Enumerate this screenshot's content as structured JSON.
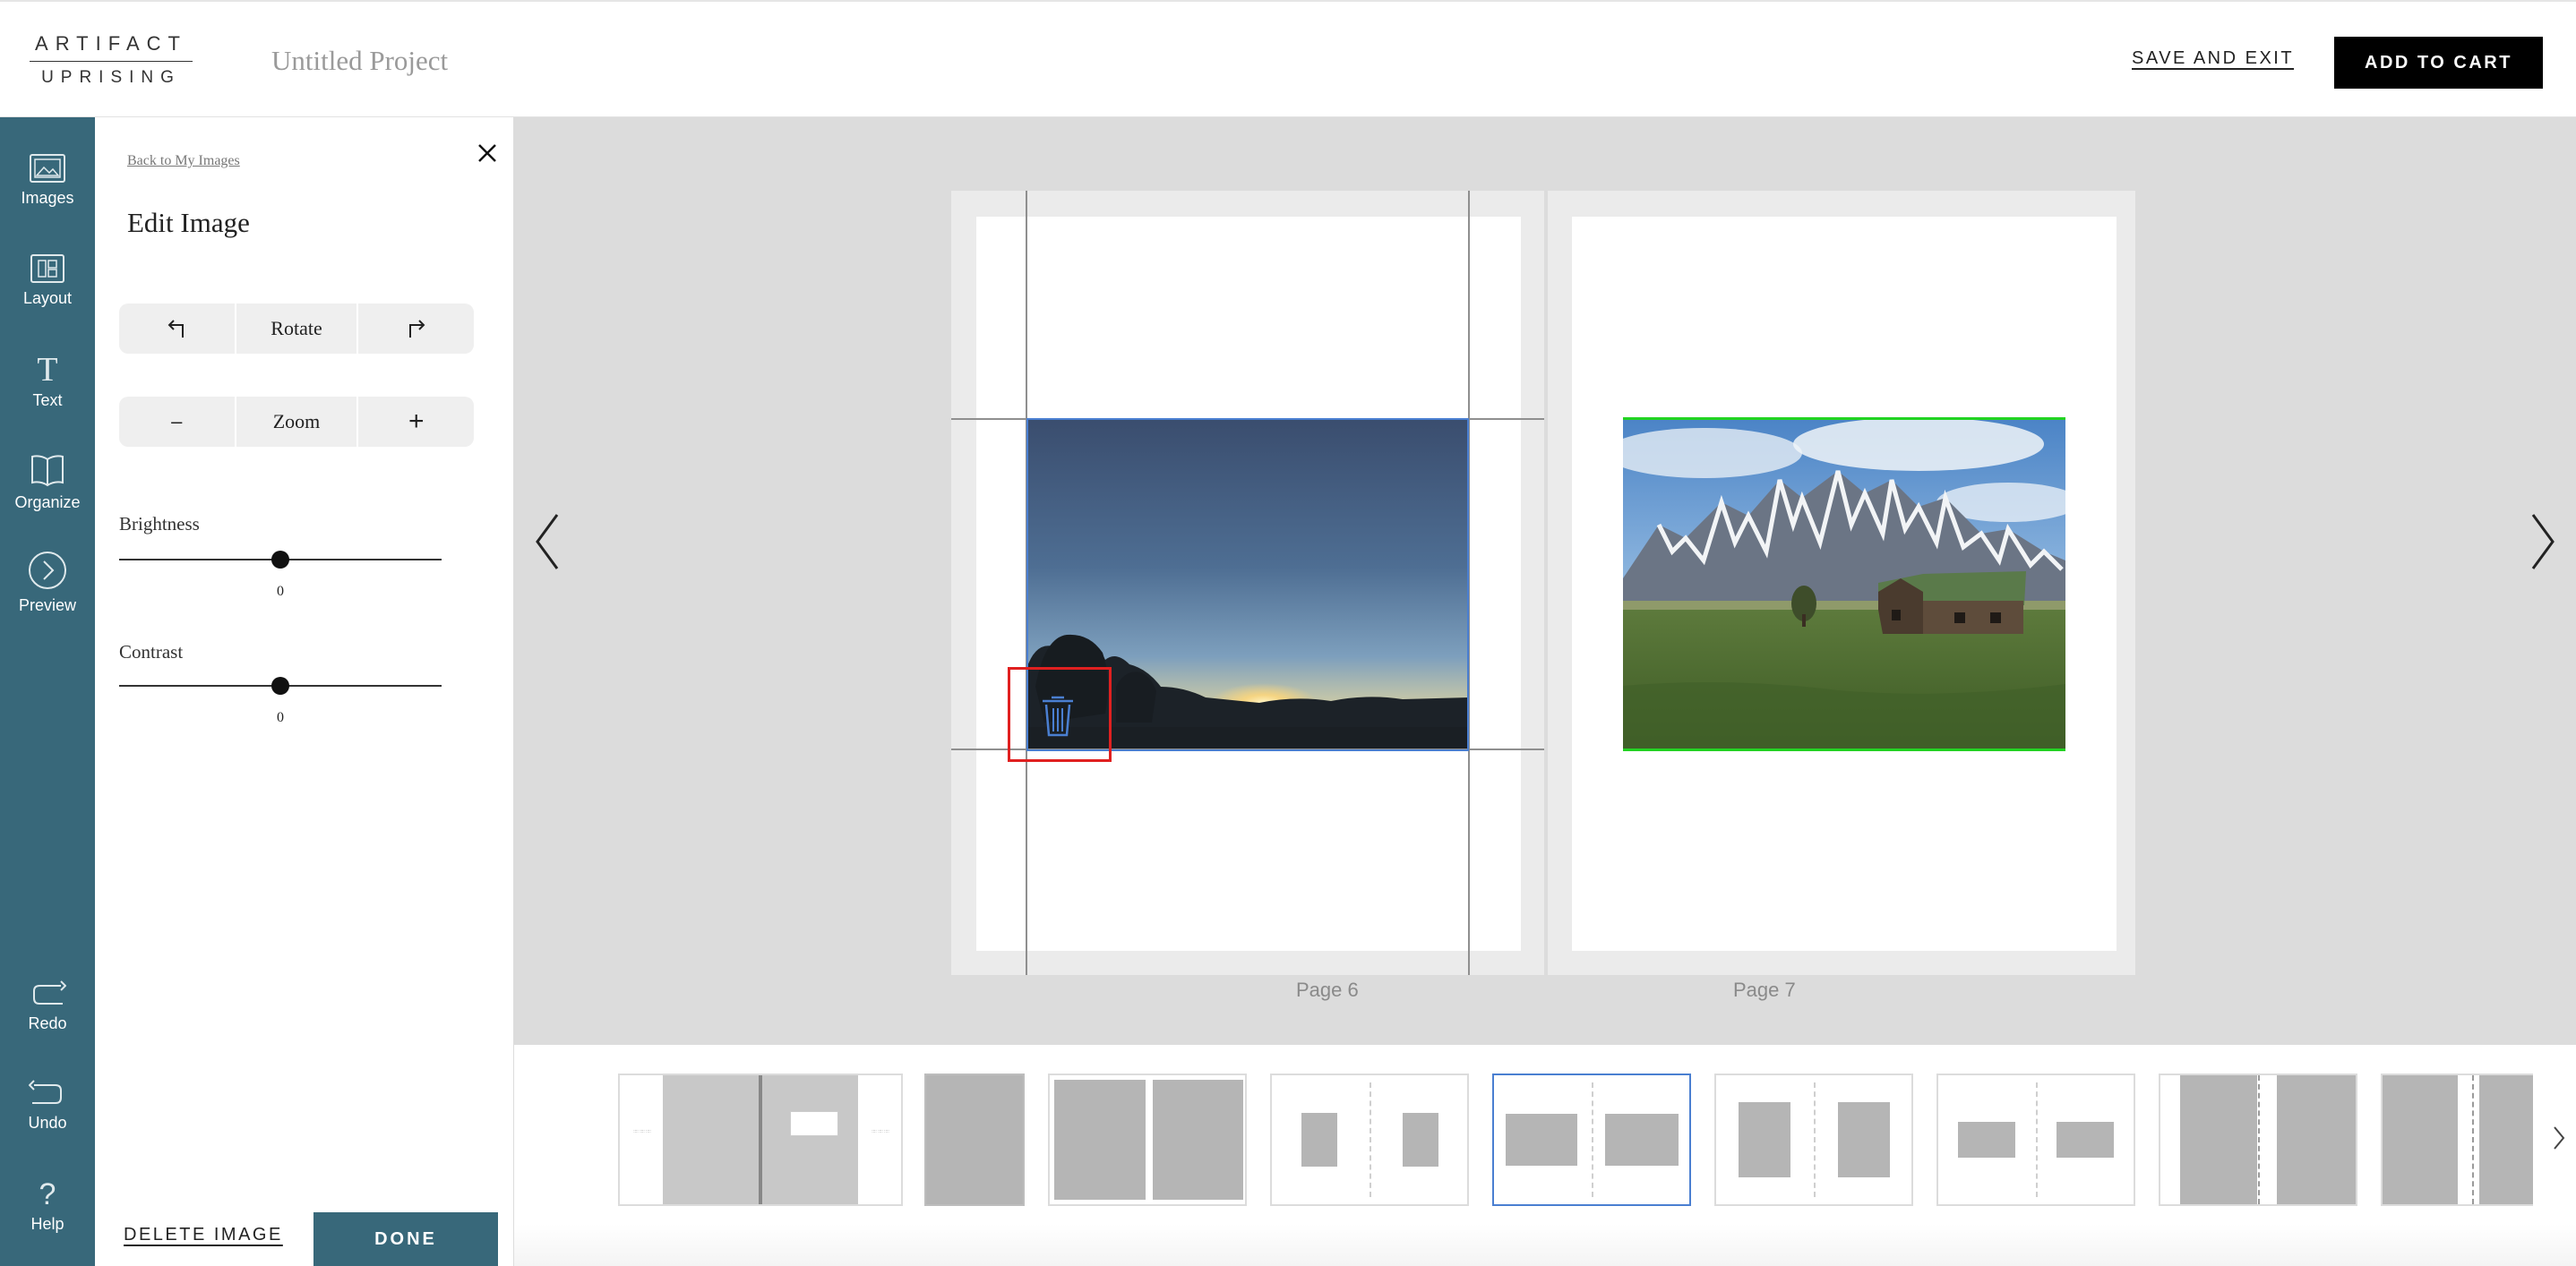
{
  "header": {
    "logo_line1": "ARTIFACT",
    "logo_line2": "UPRISING",
    "project_title": "Untitled Project",
    "save_exit_label": "SAVE AND EXIT",
    "add_to_cart_label": "ADD TO CART"
  },
  "sidebar": {
    "items": [
      {
        "label": "Images",
        "icon": "image-icon"
      },
      {
        "label": "Layout",
        "icon": "layout-icon"
      },
      {
        "label": "Text",
        "icon": "text-icon"
      },
      {
        "label": "Organize",
        "icon": "book-icon"
      },
      {
        "label": "Preview",
        "icon": "chevron-circle-icon"
      },
      {
        "label": "Redo",
        "icon": "redo-icon"
      },
      {
        "label": "Undo",
        "icon": "undo-icon"
      },
      {
        "label": "Help",
        "icon": "question-icon"
      }
    ],
    "accent_color": "#38687a"
  },
  "panel": {
    "back_link": "Back to My Images",
    "title": "Edit Image",
    "rotate": {
      "left_icon": "rotate-left-icon",
      "label": "Rotate",
      "right_icon": "rotate-right-icon"
    },
    "zoom": {
      "minus": "–",
      "label": "Zoom",
      "plus": "+"
    },
    "brightness": {
      "label": "Brightness",
      "value": "0",
      "level_fraction": 0.5
    },
    "contrast": {
      "label": "Contrast",
      "value": "0",
      "level_fraction": 0.5
    },
    "delete_label": "DELETE IMAGE",
    "done_label": "DONE"
  },
  "spread": {
    "left_page_label": "Page 6",
    "right_page_label": "Page 7",
    "left_photo": "sunset silhouette photo",
    "right_photo": "mountain barn photo"
  },
  "filmstrip": {
    "selected_index": 4,
    "layouts": [
      {
        "name": "cover-text-layout"
      },
      {
        "name": "full-bleed-single-layout"
      },
      {
        "name": "two-full-pages-layout"
      },
      {
        "name": "two-small-portrait-layout"
      },
      {
        "name": "two-landscape-layout"
      },
      {
        "name": "two-portrait-layout"
      },
      {
        "name": "two-small-landscape-layout"
      },
      {
        "name": "split-panels-layout"
      },
      {
        "name": "split-panels-narrow-layout"
      }
    ]
  }
}
